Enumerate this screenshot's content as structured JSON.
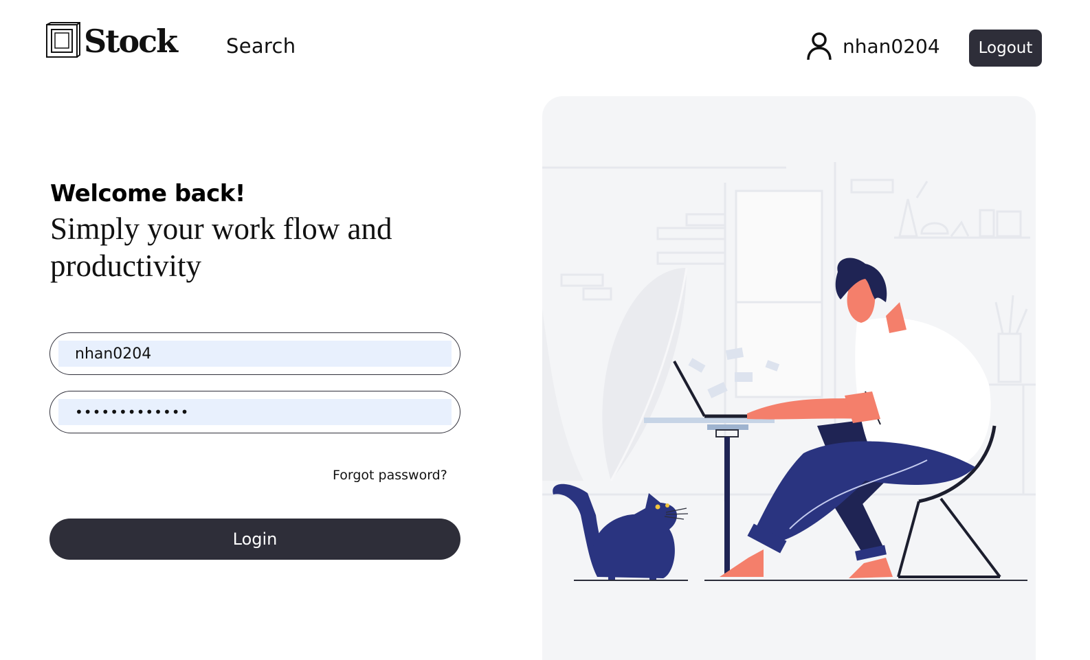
{
  "header": {
    "logo_text": "Stock",
    "logo_icon": "box-icon",
    "nav_search": "Search",
    "username": "nhan0204",
    "user_icon": "user-icon",
    "logout_label": "Logout"
  },
  "login": {
    "welcome": "Welcome back!",
    "tagline": "Simply your work flow and productivity",
    "username_value": "nhan0204",
    "password_value": "•••••••••••••",
    "forgot_label": "Forgot password?",
    "login_label": "Login"
  },
  "colors": {
    "primary_dark": "#2e2e39",
    "input_fill": "#e8f0fd",
    "panel_bg": "#f4f5f7",
    "illustration_navy": "#2a3480",
    "illustration_skin": "#f47f6b"
  }
}
